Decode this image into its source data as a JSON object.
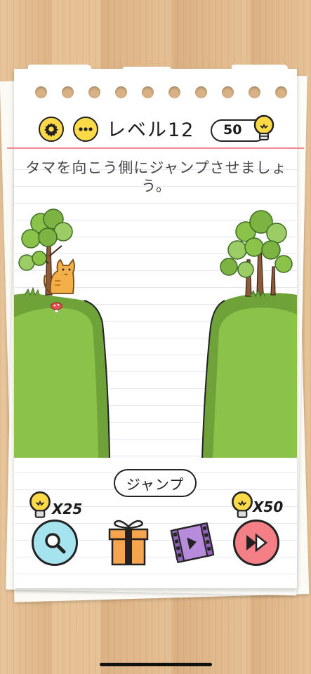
{
  "header": {
    "level_text": "レベル12",
    "hint_count": "50"
  },
  "instruction": "タマを向こう側にジャンプさせましょう。",
  "jump_button_label": "ジャンプ",
  "hint_cost_label": "X25",
  "skip_cost_label": "X50",
  "icons": {
    "settings": "gear-icon",
    "more": "ellipsis-icon",
    "hint_bulb": "lightbulb-icon",
    "search": "magnifier-icon",
    "gift": "gift-icon",
    "video": "video-film-icon",
    "skip": "fast-forward-icon"
  },
  "colors": {
    "button_yellow": "#fcd947",
    "grass": "#8bc34a",
    "grass_dark": "#6fa33a",
    "search_btn": "#a5e3ef",
    "skip_btn": "#f47f86",
    "video": "#b68bdc",
    "gift": "#f6a54f",
    "margin_line": "#ef8a95"
  }
}
